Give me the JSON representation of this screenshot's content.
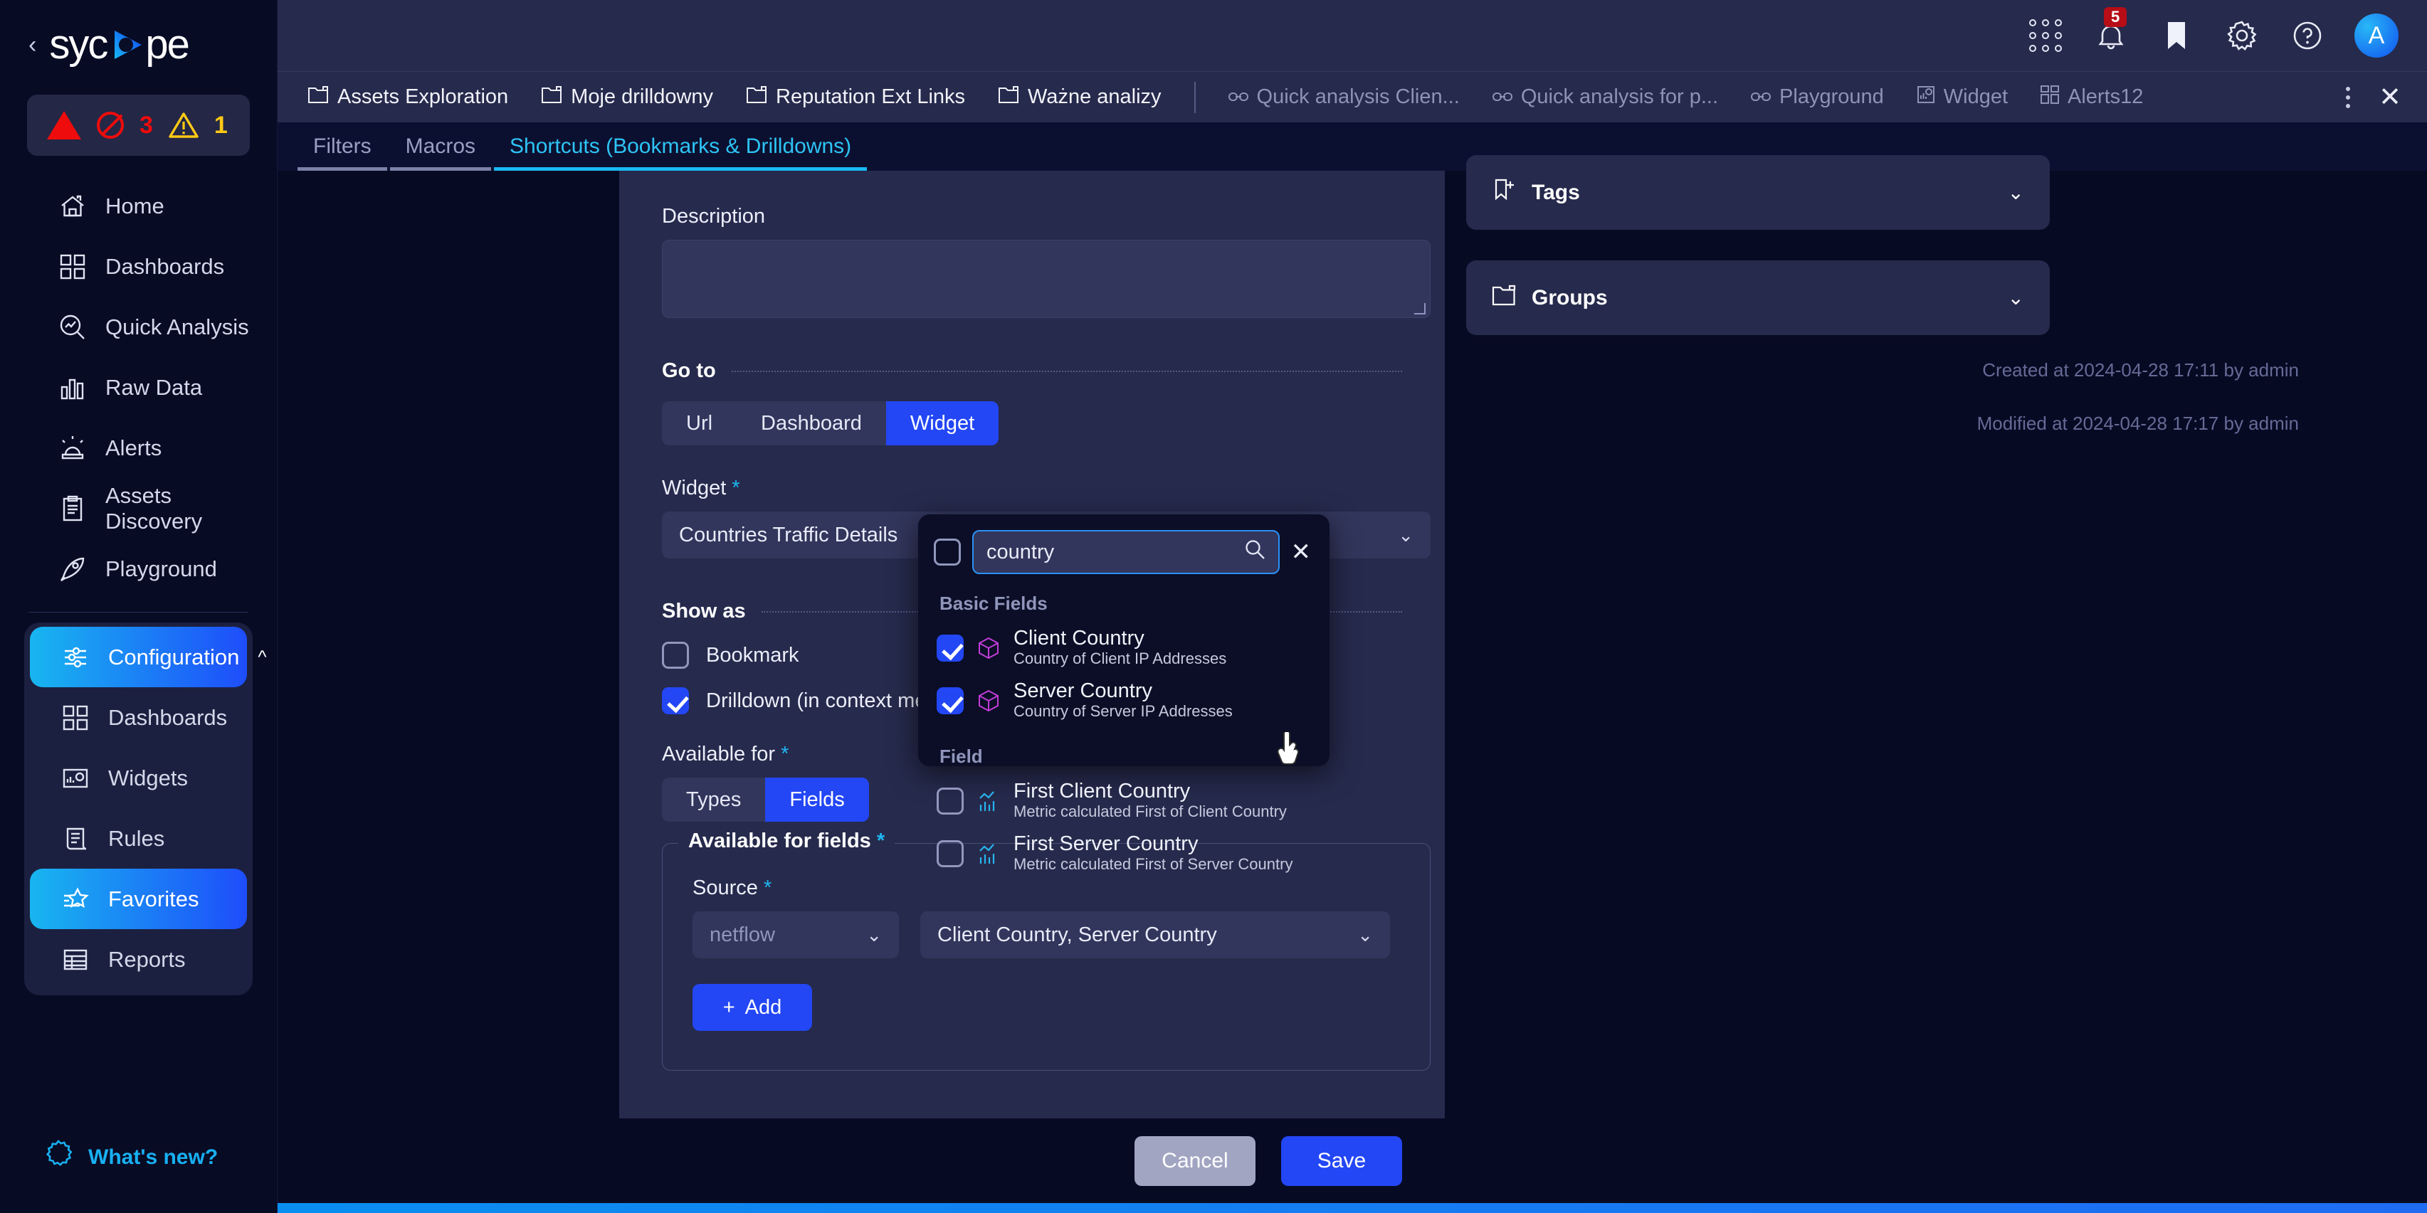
{
  "brand": {
    "name": "sycope",
    "collapse_icon": "chevron-left-icon"
  },
  "alert_bar": {
    "critical_icon": "triangle-alert-icon",
    "blocked_icon": "ban-icon",
    "blocked_count": "3",
    "warning_icon": "warning-triangle-icon",
    "warning_count": "1"
  },
  "sidebar": {
    "items": [
      {
        "label": "Home",
        "icon": "home-icon"
      },
      {
        "label": "Dashboards",
        "icon": "grid-icon"
      },
      {
        "label": "Quick Analysis",
        "icon": "analysis-magnifier-icon"
      },
      {
        "label": "Raw Data",
        "icon": "bar-chart-icon"
      },
      {
        "label": "Alerts",
        "icon": "siren-icon"
      },
      {
        "label": "Assets Discovery",
        "icon": "clipboard-icon"
      },
      {
        "label": "Playground",
        "icon": "rocket-icon"
      }
    ],
    "configuration": {
      "label": "Configuration",
      "icon": "sliders-icon",
      "chevron": "chevron-up-icon"
    },
    "config_items": [
      {
        "label": "Dashboards",
        "icon": "grid-icon"
      },
      {
        "label": "Widgets",
        "icon": "widget-icon"
      },
      {
        "label": "Rules",
        "icon": "scroll-icon"
      },
      {
        "label": "Favorites",
        "icon": "star-list-icon"
      },
      {
        "label": "Reports",
        "icon": "table-icon"
      }
    ],
    "whats_new": {
      "label": "What's new?",
      "icon": "new-badge-icon"
    }
  },
  "header": {
    "icons": [
      {
        "name": "apps-grid-icon"
      },
      {
        "name": "bell-icon",
        "badge": "5"
      },
      {
        "name": "bookmark-icon"
      },
      {
        "name": "gear-icon"
      },
      {
        "name": "help-icon"
      }
    ],
    "avatar": "A"
  },
  "tabbar": {
    "tabs": [
      {
        "label": "Assets Exploration",
        "icon": "folder-icon",
        "dim": false
      },
      {
        "label": "Moje drilldowny",
        "icon": "folder-icon",
        "dim": false
      },
      {
        "label": "Reputation Ext Links",
        "icon": "folder-icon",
        "dim": false
      },
      {
        "label": "Ważne analizy",
        "icon": "folder-icon",
        "dim": false
      }
    ],
    "tabs_right": [
      {
        "label": "Quick analysis Clien...",
        "icon": "link-icon",
        "dim": true
      },
      {
        "label": "Quick analysis for p...",
        "icon": "link-icon",
        "dim": true
      },
      {
        "label": "Playground",
        "icon": "link-icon",
        "dim": true
      },
      {
        "label": "Widget",
        "icon": "widget-icon",
        "dim": true
      },
      {
        "label": "Alerts12",
        "icon": "grid-icon",
        "dim": true
      }
    ],
    "more_icon": "kebab-menu-icon",
    "close_icon": "close-icon"
  },
  "subtabs": [
    {
      "label": "Filters",
      "active": false
    },
    {
      "label": "Macros",
      "active": false
    },
    {
      "label": "Shortcuts (Bookmarks & Drilldowns)",
      "active": true
    }
  ],
  "form": {
    "description_label": "Description",
    "description_value": "",
    "goto_label": "Go to",
    "goto_options": [
      "Url",
      "Dashboard",
      "Widget"
    ],
    "goto_selected": "Widget",
    "widget_label": "Widget",
    "widget_value": "Countries Traffic Details",
    "show_as_label": "Show as",
    "bookmark_label": "Bookmark",
    "bookmark_checked": false,
    "drilldown_label": "Drilldown (in context menu)",
    "drilldown_checked": true,
    "available_for_label": "Available for",
    "available_for_options": [
      "Types",
      "Fields"
    ],
    "available_for_selected": "Fields",
    "available_for_fields_label": "Available for fields",
    "source_label": "Source",
    "source_value": "netflow",
    "fields_value": "Client Country, Server Country",
    "add_label": "Add"
  },
  "dropdown": {
    "select_all_checked": false,
    "search_value": "country",
    "search_icon": "search-icon",
    "clear_icon": "close-icon",
    "groups": [
      {
        "name": "Basic Fields",
        "items": [
          {
            "title": "Client Country",
            "subtitle": "Country of Client IP Addresses",
            "checked": true,
            "icon": "cube-icon"
          },
          {
            "title": "Server Country",
            "subtitle": "Country of Server IP Addresses",
            "checked": true,
            "icon": "cube-icon"
          }
        ]
      },
      {
        "name": "Field",
        "items": [
          {
            "title": "First Client Country",
            "subtitle": "Metric calculated First of Client Country",
            "checked": false,
            "icon": "metric-chart-icon"
          },
          {
            "title": "First Server Country",
            "subtitle": "Metric calculated First of Server Country",
            "checked": false,
            "icon": "metric-chart-icon"
          }
        ]
      }
    ]
  },
  "right_panel": {
    "tags": {
      "label": "Tags",
      "icon": "tag-bookmark-icon",
      "chevron": "chevron-down-icon"
    },
    "groups": {
      "label": "Groups",
      "icon": "folder-icon",
      "chevron": "chevron-down-icon"
    },
    "created": "Created at 2024-04-28 17:11 by admin",
    "modified": "Modified at 2024-04-28 17:17 by admin"
  },
  "actions": {
    "cancel": "Cancel",
    "save": "Save"
  },
  "colors": {
    "accent_blue": "#2347f5",
    "accent_cyan": "#19b9f3",
    "panel": "#262a4c",
    "bg": "#070a23",
    "danger": "#ee0c0c",
    "warning": "#ffc915",
    "cube_purple": "#c23cd8"
  }
}
